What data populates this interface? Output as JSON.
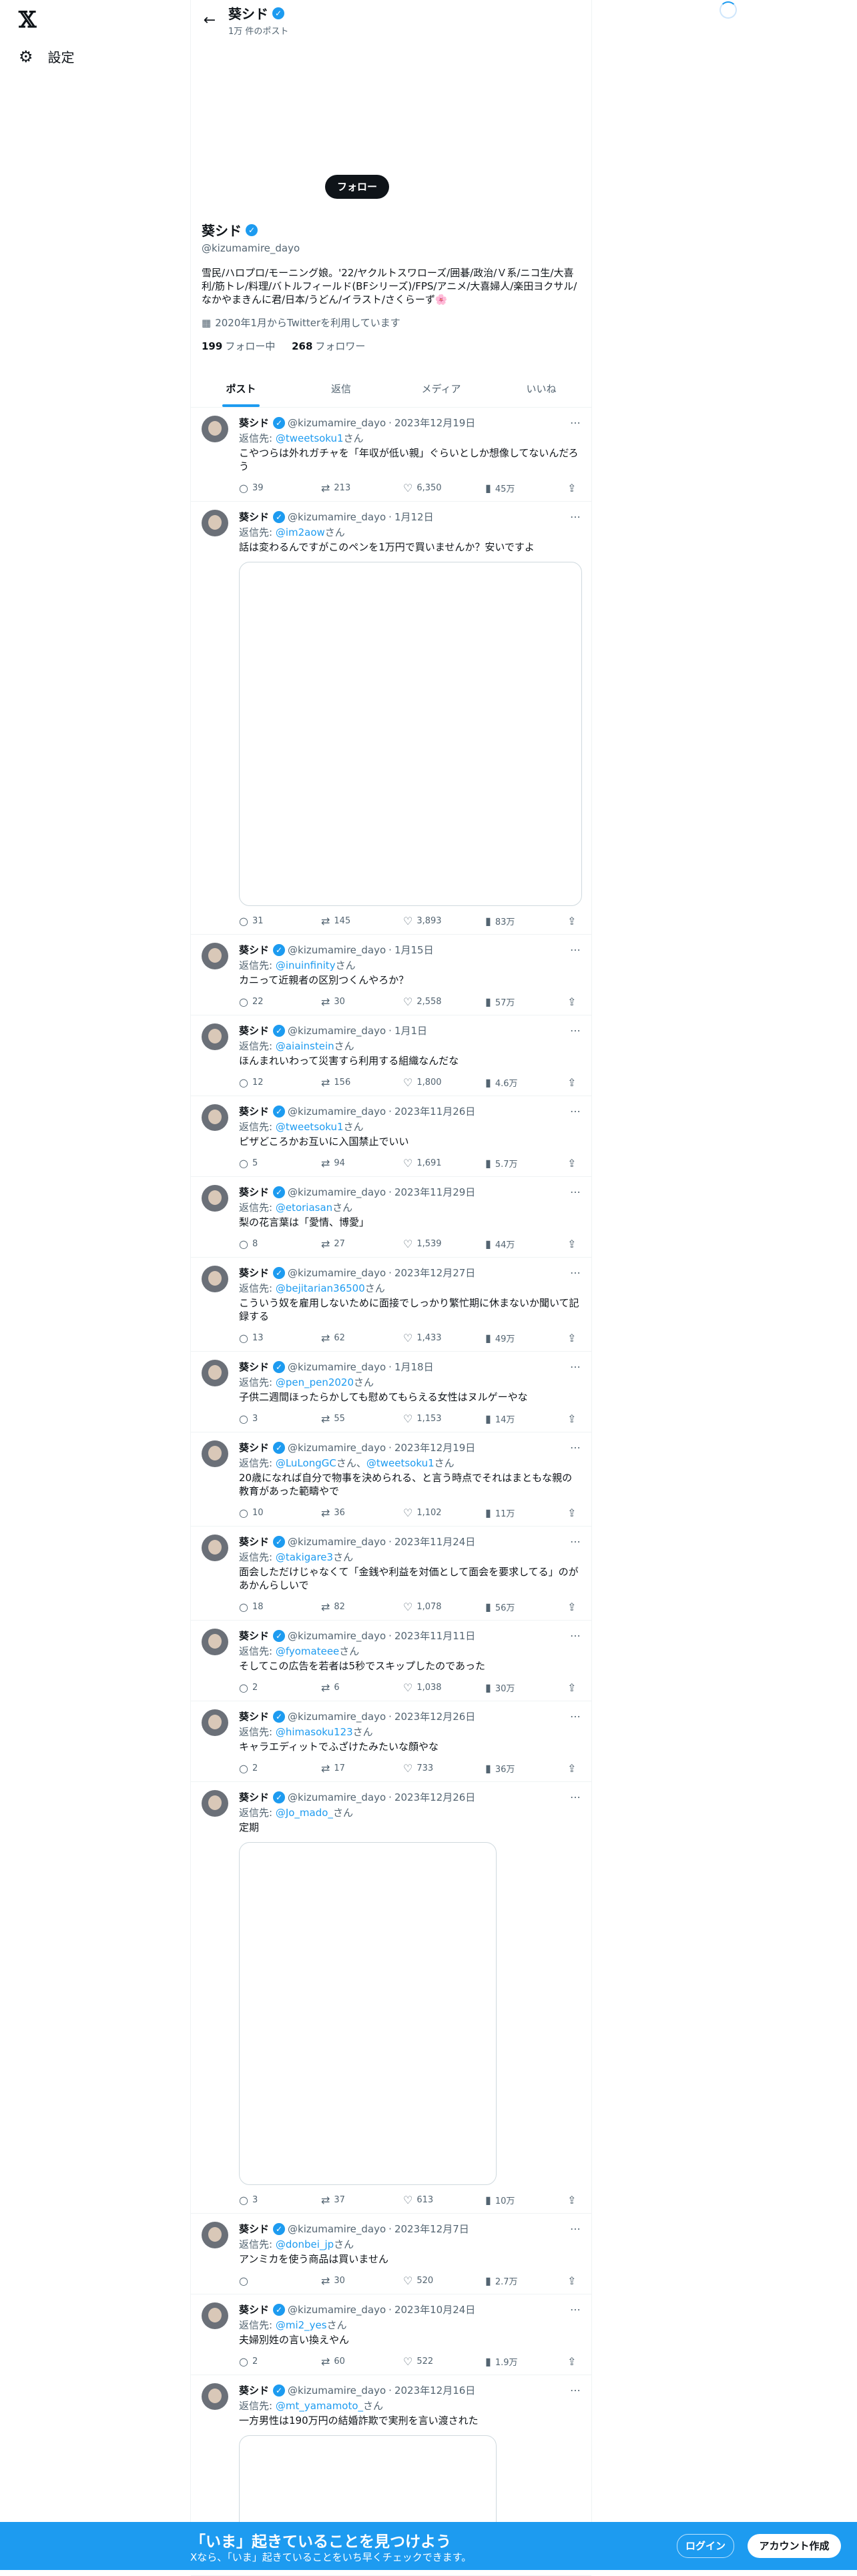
{
  "nav": {
    "settings_label": "設定"
  },
  "header": {
    "name": "葵シド",
    "post_count": "1万 件のポスト"
  },
  "profile": {
    "name": "葵シド",
    "handle": "@kizumamire_dayo",
    "bio": "雪民/ハロプロ/モーニング娘。'22/ヤクルトスワローズ/囲碁/政治/Ｖ系/ニコ生/大喜利/筋トレ/料理/バトルフィールド(BFシリーズ)/FPS/アニメ/大喜婦人/楽田ヨクサル/なかやまきんに君/日本/うどん/イラスト/さくらーず🌸",
    "joined": "2020年1月からTwitterを利用しています",
    "following": "199",
    "following_label": "フォロー中",
    "followers": "268",
    "followers_label": "フォロワー",
    "follow_button": "フォロー"
  },
  "tabs": [
    "ポスト",
    "返信",
    "メディア",
    "いいね"
  ],
  "tweets": [
    {
      "name": "葵シド",
      "handle": "@kizumamire_dayo",
      "date": "2023年12月19日",
      "reply_to": "@tweetsoku1",
      "reply_suffix": "さん",
      "text": "こやつらは外れガチャを「年収が低い親」ぐらいとしか想像してないんだろう",
      "replies": "39",
      "retweets": "213",
      "likes": "6,350",
      "views": "45万"
    },
    {
      "name": "葵シド",
      "handle": "@kizumamire_dayo",
      "date": "1月12日",
      "reply_to": "@im2aow",
      "reply_suffix": "さん",
      "text": "話は変わるんですがこのペンを1万円で買いませんか？安いですよ",
      "replies": "31",
      "retweets": "145",
      "likes": "3,893",
      "views": "83万"
    },
    {
      "name": "葵シド",
      "handle": "@kizumamire_dayo",
      "date": "1月15日",
      "reply_to": "@inuinfinity",
      "reply_suffix": "さん",
      "text": "カニって近親者の区別つくんやろか？",
      "replies": "22",
      "retweets": "30",
      "likes": "2,558",
      "views": "57万"
    },
    {
      "name": "葵シド",
      "handle": "@kizumamire_dayo",
      "date": "1月1日",
      "reply_to": "@aiainstein",
      "reply_suffix": "さん",
      "text": "ほんまれいわって災害すら利用する組織なんだな",
      "replies": "12",
      "retweets": "156",
      "likes": "1,800",
      "views": "4.6万"
    },
    {
      "name": "葵シド",
      "handle": "@kizumamire_dayo",
      "date": "2023年11月26日",
      "reply_to": "@tweetsoku1",
      "reply_suffix": "さん",
      "text": "ピザどころかお互いに入国禁止でいい",
      "replies": "5",
      "retweets": "94",
      "likes": "1,691",
      "views": "5.7万"
    },
    {
      "name": "葵シド",
      "handle": "@kizumamire_dayo",
      "date": "2023年11月29日",
      "reply_to": "@etoriasan",
      "reply_suffix": "さん",
      "text": "梨の花言葉は「愛情、博愛」",
      "replies": "8",
      "retweets": "27",
      "likes": "1,539",
      "views": "44万"
    },
    {
      "name": "葵シド",
      "handle": "@kizumamire_dayo",
      "date": "2023年12月27日",
      "reply_to": "@bejitarian36500",
      "reply_suffix": "さん",
      "text": "こういう奴を雇用しないために面接でしっかり繁忙期に休まないか聞いて記録する",
      "replies": "13",
      "retweets": "62",
      "likes": "1,433",
      "views": "49万"
    },
    {
      "name": "葵シド",
      "handle": "@kizumamire_dayo",
      "date": "1月18日",
      "reply_to": "@pen_pen2020",
      "reply_suffix": "さん",
      "text": "子供二週間ほったらかしても慰めてもらえる女性はヌルゲーやな",
      "replies": "3",
      "retweets": "55",
      "likes": "1,153",
      "views": "14万"
    },
    {
      "name": "葵シド",
      "handle": "@kizumamire_dayo",
      "date": "2023年12月19日",
      "reply_to": "@LuLongGC",
      "reply_extra": "@tweetsoku1",
      "reply_suffix": "さん",
      "text": "20歳になれば自分で物事を決められる、と言う時点でそれはまともな親の教育があった範疇やで",
      "replies": "10",
      "retweets": "36",
      "likes": "1,102",
      "views": "11万"
    },
    {
      "name": "葵シド",
      "handle": "@kizumamire_dayo",
      "date": "2023年11月24日",
      "reply_to": "@takigare3",
      "reply_suffix": "さん",
      "text": "面会しただけじゃなくて「金銭や利益を対価として面会を要求してる」のがあかんらしいで",
      "replies": "18",
      "retweets": "82",
      "likes": "1,078",
      "views": "56万"
    },
    {
      "name": "葵シド",
      "handle": "@kizumamire_dayo",
      "date": "2023年11月11日",
      "reply_to": "@fyomateee",
      "reply_suffix": "さん",
      "text": "そしてこの広告を若者は5秒でスキップしたのであった",
      "replies": "2",
      "retweets": "6",
      "likes": "1,038",
      "views": "30万"
    },
    {
      "name": "葵シド",
      "handle": "@kizumamire_dayo",
      "date": "2023年12月26日",
      "reply_to": "@himasoku123",
      "reply_suffix": "さん",
      "text": "キャラエディットでふざけたみたいな顔やな",
      "replies": "2",
      "retweets": "17",
      "likes": "733",
      "views": "36万"
    },
    {
      "name": "葵シド",
      "handle": "@kizumamire_dayo",
      "date": "2023年12月26日",
      "reply_to": "@Jo_mado_",
      "reply_suffix": "さん",
      "text": "定期",
      "replies": "3",
      "retweets": "37",
      "likes": "613",
      "views": "10万"
    },
    {
      "name": "葵シド",
      "handle": "@kizumamire_dayo",
      "date": "2023年12月7日",
      "reply_to": "@donbei_jp",
      "reply_suffix": "さん",
      "text": "アンミカを使う商品は買いません",
      "replies": "",
      "retweets": "30",
      "likes": "520",
      "views": "2.7万"
    },
    {
      "name": "葵シド",
      "handle": "@kizumamire_dayo",
      "date": "2023年10月24日",
      "reply_to": "@mi2_yes",
      "reply_suffix": "さん",
      "text": "夫婦別姓の言い換えやん",
      "replies": "2",
      "retweets": "60",
      "likes": "522",
      "views": "1.9万"
    },
    {
      "name": "葵シド",
      "handle": "@kizumamire_dayo",
      "date": "2023年12月16日",
      "reply_to": "@mt_yamamoto_",
      "reply_suffix": "さん",
      "text": "一方男性は190万円の結婚詐欺で実刑を言い渡された"
    }
  ],
  "common": {
    "reply_prefix": "返信先: ",
    "dot": "·"
  },
  "bottom": {
    "title": "「いま」起きていることを見つけよう",
    "subtitle": "Xなら、「いま」起きていることをいち早くチェックできます。",
    "login": "ログイン",
    "signup": "アカウント作成"
  },
  "colors": {
    "accent": "#1d9bf0",
    "text": "#0f1419",
    "secondary": "#536471"
  }
}
